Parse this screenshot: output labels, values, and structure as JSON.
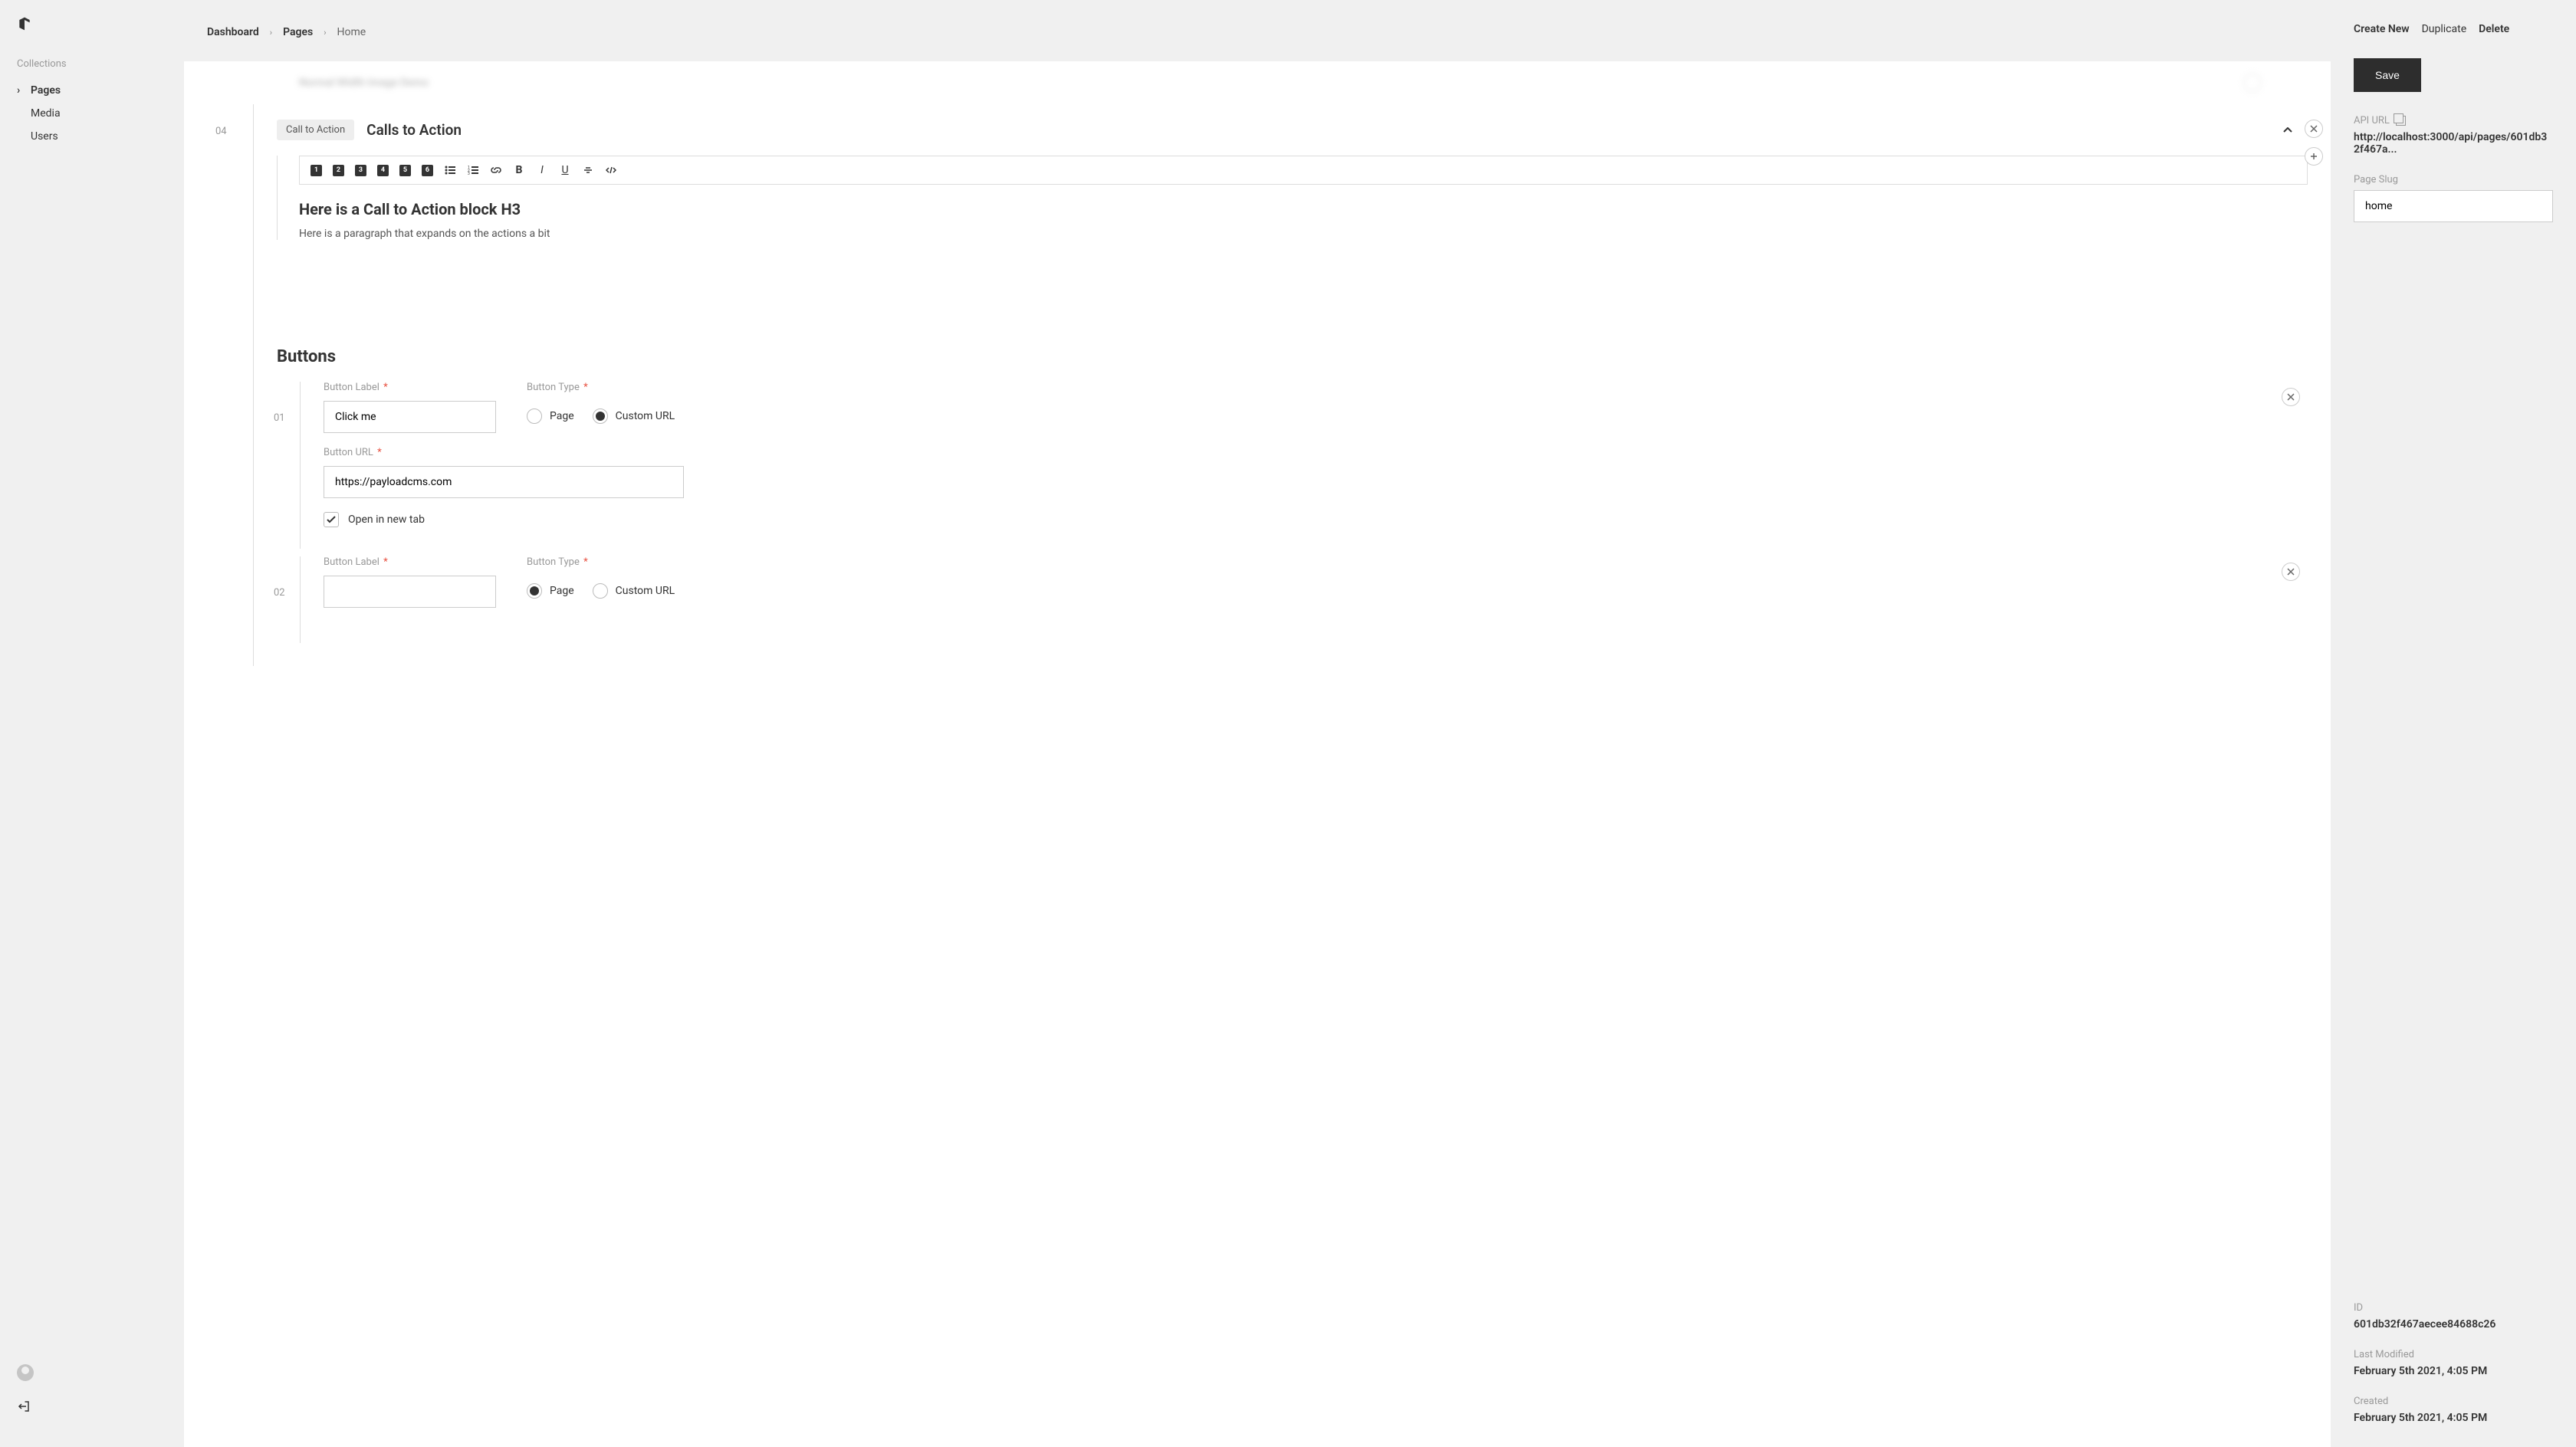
{
  "sidebar": {
    "section_label": "Collections",
    "items": [
      {
        "label": "Pages",
        "active": true
      },
      {
        "label": "Media",
        "active": false
      },
      {
        "label": "Users",
        "active": false
      }
    ]
  },
  "breadcrumb": {
    "items": [
      "Dashboard",
      "Pages",
      "Home"
    ]
  },
  "blurred_text": "Normal Width Image Demo",
  "block": {
    "index": "04",
    "pill": "Call to Action",
    "title": "Calls to Action",
    "toolbar_h": [
      "1",
      "2",
      "3",
      "4",
      "5",
      "6"
    ],
    "content": {
      "h3": "Here is a Call to Action block H3",
      "p": "Here is a paragraph that expands on the actions a bit"
    }
  },
  "buttons_section": {
    "title": "Buttons",
    "rows": [
      {
        "index": "01",
        "label_field": "Button Label",
        "label_value": "Click me",
        "type_field": "Button Type",
        "type_options": [
          "Page",
          "Custom URL"
        ],
        "type_selected": "Custom URL",
        "url_field": "Button URL",
        "url_value": "https://payloadcms.com",
        "newtab_label": "Open in new tab",
        "newtab_checked": true
      },
      {
        "index": "02",
        "label_field": "Button Label",
        "label_value": "",
        "type_field": "Button Type",
        "type_options": [
          "Page",
          "Custom URL"
        ],
        "type_selected": "Page"
      }
    ]
  },
  "panel": {
    "actions": {
      "create": "Create New",
      "duplicate": "Duplicate",
      "delete": "Delete"
    },
    "save": "Save",
    "api_label": "API URL",
    "api_value": "http://localhost:3000/api/pages/601db32f467a...",
    "slug_label": "Page Slug",
    "slug_value": "home",
    "id_label": "ID",
    "id_value": "601db32f467aecee84688c26",
    "modified_label": "Last Modified",
    "modified_value": "February 5th 2021, 4:05 PM",
    "created_label": "Created",
    "created_value": "February 5th 2021, 4:05 PM"
  },
  "required_marker": "*"
}
